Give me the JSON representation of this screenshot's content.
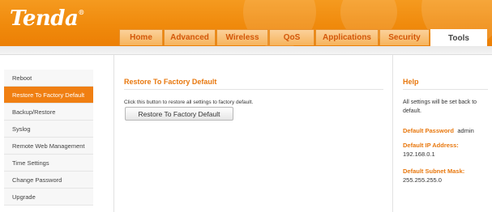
{
  "brand": {
    "logo_text": "Tenda",
    "logo_mark": "®"
  },
  "tabs": [
    {
      "label": "Home",
      "active": false
    },
    {
      "label": "Advanced",
      "active": false
    },
    {
      "label": "Wireless",
      "active": false
    },
    {
      "label": "QoS",
      "active": false
    },
    {
      "label": "Applications",
      "active": false
    },
    {
      "label": "Security",
      "active": false
    },
    {
      "label": "Tools",
      "active": true
    }
  ],
  "sidebar": {
    "items": [
      {
        "label": "Reboot",
        "active": false
      },
      {
        "label": "Restore To Factory Default",
        "active": true
      },
      {
        "label": "Backup/Restore",
        "active": false
      },
      {
        "label": "Syslog",
        "active": false
      },
      {
        "label": "Remote Web Management",
        "active": false
      },
      {
        "label": "Time Settings",
        "active": false
      },
      {
        "label": "Change Password",
        "active": false
      },
      {
        "label": "Upgrade",
        "active": false
      }
    ]
  },
  "main": {
    "title": "Restore To Factory Default",
    "description": "Click this button to restore all settings to factory default.",
    "button_label": "Restore To Factory Default"
  },
  "help": {
    "title": "Help",
    "text": "All settings will be set back to default.",
    "password_label": "Default Password",
    "password_value": "admin",
    "ip_label": "Default IP Address:",
    "ip_value": "192.168.0.1",
    "mask_label": "Default Subnet Mask:",
    "mask_value": "255.255.255.0"
  },
  "colors": {
    "accent": "#f08a0c",
    "active_nav": "#f07f12",
    "heading": "#e8780e"
  }
}
